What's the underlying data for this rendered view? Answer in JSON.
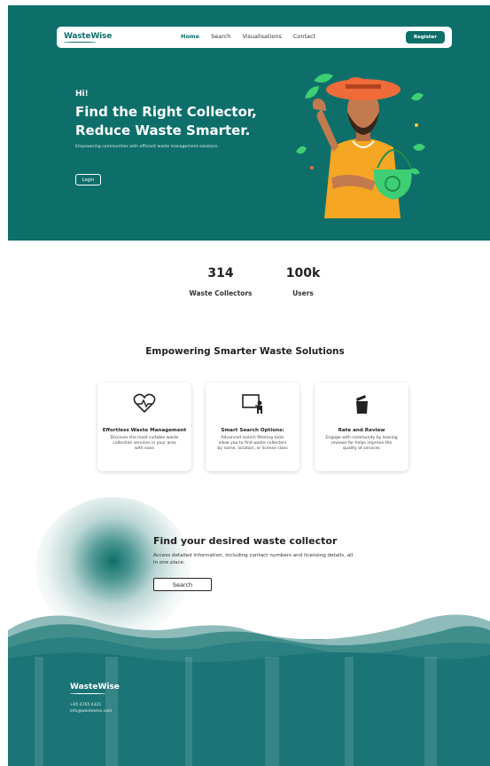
{
  "nav": {
    "logo": "WasteWise",
    "links": [
      "Home",
      "Search",
      "Visualisations",
      "Contact"
    ],
    "active": "Home",
    "register_label": "Register"
  },
  "hero": {
    "greeting": "Hi!",
    "title_line1": "Find the Right Collector,",
    "title_line2": "Reduce Waste Smarter.",
    "subtitle": "Empowering communities with efficient waste management solutions.",
    "login_label": "Login",
    "illustration": "man-with-hat-and-recycle-bag-illustration"
  },
  "stats": [
    {
      "value": "314",
      "label": "Waste Collectors"
    },
    {
      "value": "100k",
      "label": "Users"
    }
  ],
  "section": {
    "heading": "Empowering Smarter Waste Solutions",
    "cards": [
      {
        "icon": "heart-pulse-icon",
        "title": "Effortless Waste Management",
        "description": "Discover the most suitable waste collection services in your area with ease"
      },
      {
        "icon": "presentation-board-icon",
        "title": "Smart Search Options:",
        "description": "Advanced search filtering tools allow you to find waste collectors by name, location, or license class"
      },
      {
        "icon": "trash-bin-icon",
        "title": "Rate and Review",
        "description": "Engage with community by leaving reviews for helps improve the quality of services"
      }
    ]
  },
  "find": {
    "title": "Find your desired waste collector",
    "description": "Access detailed information, including contact numbers and licensing details, all in one place.",
    "button_label": "Search"
  },
  "footer": {
    "logo": "WasteWise",
    "phone": "+65 6765 4321",
    "email": "info@wastewise.com"
  },
  "colors": {
    "primary": "#0e6f6a",
    "footer_dark": "#1b7476",
    "wave_light": "#3f8e8c"
  }
}
